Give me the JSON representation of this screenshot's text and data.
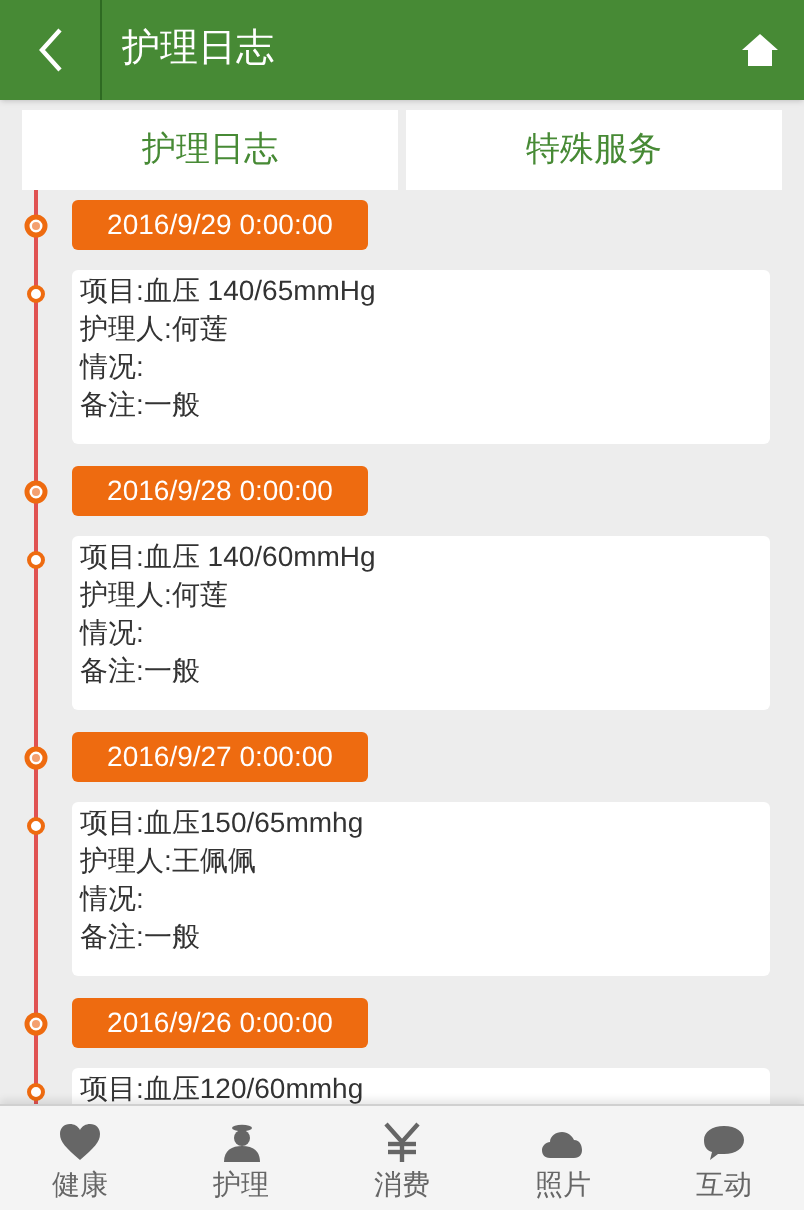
{
  "header": {
    "title": "护理日志"
  },
  "tabs": [
    {
      "label": "护理日志"
    },
    {
      "label": "特殊服务"
    }
  ],
  "entries": [
    {
      "date": "2016/9/29 0:00:00",
      "lines": [
        "项目:血压 140/65mmHg",
        "护理人:何莲",
        "情况:",
        "备注:一般"
      ]
    },
    {
      "date": "2016/9/28 0:00:00",
      "lines": [
        "项目:血压 140/60mmHg",
        "护理人:何莲",
        "情况:",
        "备注:一般"
      ]
    },
    {
      "date": "2016/9/27 0:00:00",
      "lines": [
        "项目:血压150/65mmhg",
        "护理人:王佩佩",
        "情况:",
        "备注:一般"
      ]
    },
    {
      "date": "2016/9/26 0:00:00",
      "lines": [
        "项目:血压120/60mmhg"
      ]
    }
  ],
  "bottom_nav": [
    {
      "kind": "heart",
      "label": "健康"
    },
    {
      "kind": "nurse",
      "label": "护理"
    },
    {
      "kind": "yen",
      "label": "消费"
    },
    {
      "kind": "cloud",
      "label": "照片"
    },
    {
      "kind": "chat",
      "label": "互动"
    }
  ]
}
